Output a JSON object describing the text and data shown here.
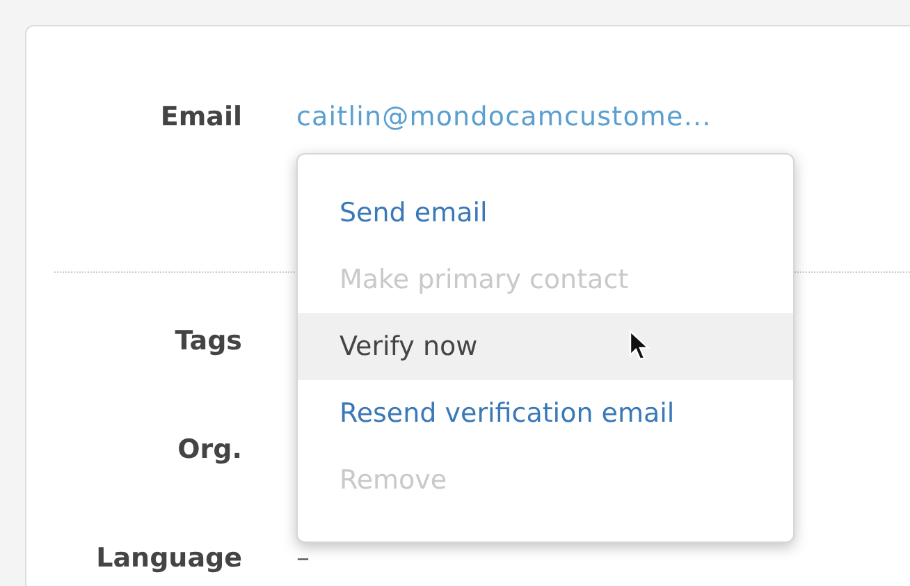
{
  "fields": [
    {
      "label": "Email",
      "value": "caitlin@mondocamcustome...",
      "kind": "link"
    },
    {
      "label": "Tags",
      "kind": "empty"
    },
    {
      "label": "Org.",
      "kind": "empty"
    },
    {
      "label": "Language",
      "value": "–",
      "kind": "text"
    }
  ],
  "menu": {
    "items": [
      {
        "label": "Send email",
        "disabled": false,
        "highlighted": false
      },
      {
        "label": "Make primary contact",
        "disabled": true,
        "highlighted": false
      },
      {
        "label": "Verify now",
        "disabled": false,
        "highlighted": true
      },
      {
        "label": "Resend verification email",
        "disabled": false,
        "highlighted": false
      },
      {
        "label": "Remove",
        "disabled": true,
        "highlighted": false
      }
    ]
  }
}
